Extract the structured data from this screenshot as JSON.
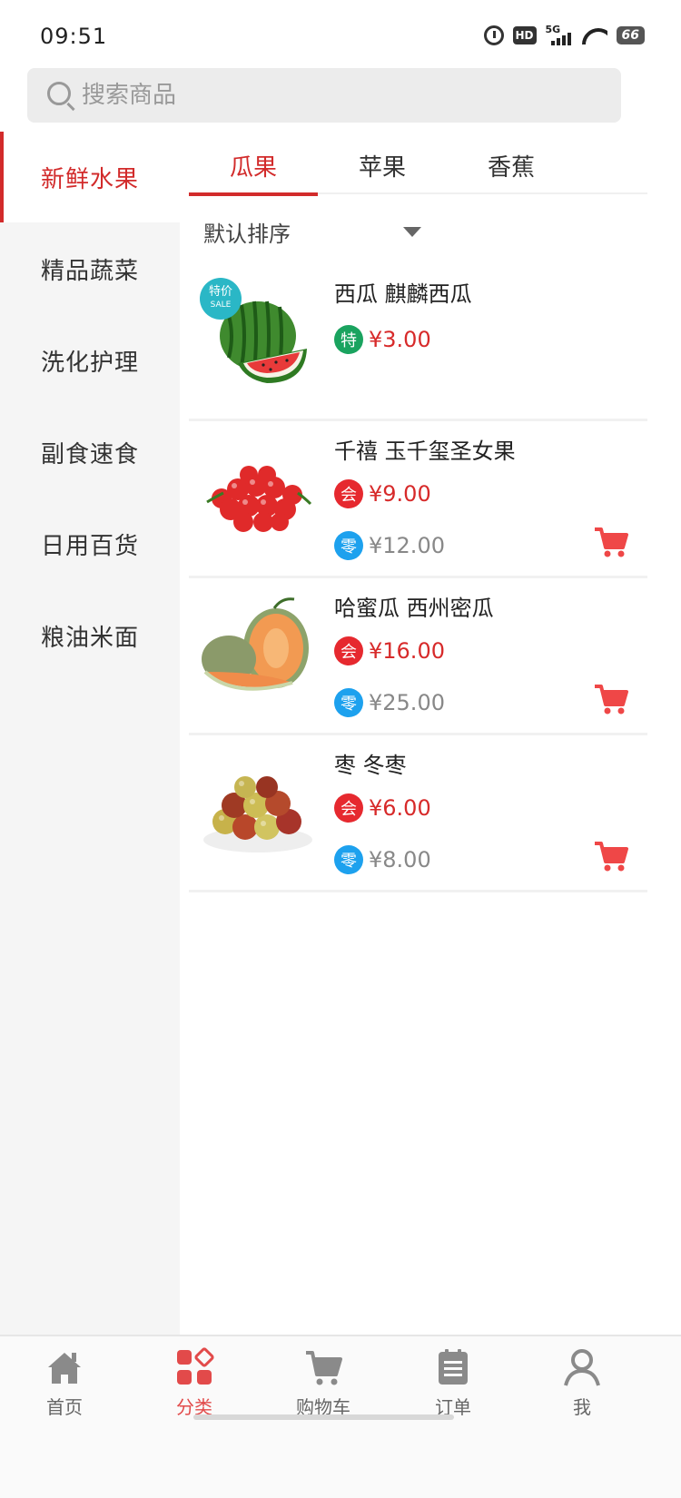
{
  "status": {
    "time": "09:51",
    "hd": "HD",
    "network": "5G",
    "battery": "66"
  },
  "search": {
    "placeholder": "搜索商品"
  },
  "sidebar": {
    "items": [
      {
        "label": "新鲜水果",
        "active": true
      },
      {
        "label": "精品蔬菜"
      },
      {
        "label": "洗化护理"
      },
      {
        "label": "副食速食"
      },
      {
        "label": "日用百货"
      },
      {
        "label": "粮油米面"
      }
    ]
  },
  "tabs": [
    {
      "label": "瓜果",
      "active": true
    },
    {
      "label": "苹果"
    },
    {
      "label": "香蕉"
    }
  ],
  "sort": {
    "label": "默认排序"
  },
  "products": [
    {
      "name": "西瓜 麒麟西瓜",
      "sale_tag": "特价",
      "sale_tag_en": "SALE",
      "badge": "特",
      "price": "¥3.00",
      "image": "watermelon"
    },
    {
      "name": "千禧 玉千玺圣女果",
      "member_badge": "会",
      "member_price": "¥9.00",
      "retail_badge": "零",
      "retail_price": "¥12.00",
      "image": "cherry-tomatoes"
    },
    {
      "name": "哈蜜瓜 西州密瓜",
      "member_badge": "会",
      "member_price": "¥16.00",
      "retail_badge": "零",
      "retail_price": "¥25.00",
      "image": "hami-melon"
    },
    {
      "name": "枣 冬枣",
      "member_badge": "会",
      "member_price": "¥6.00",
      "retail_badge": "零",
      "retail_price": "¥8.00",
      "image": "winter-jujube"
    }
  ],
  "nav": [
    {
      "label": "首页",
      "icon": "home-icon"
    },
    {
      "label": "分类",
      "icon": "category-icon",
      "active": true
    },
    {
      "label": "购物车",
      "icon": "cart-icon"
    },
    {
      "label": "订单",
      "icon": "order-icon"
    },
    {
      "label": "我",
      "icon": "user-icon"
    }
  ],
  "colors": {
    "accent": "#d22b2b",
    "special_badge": "#1aa35f",
    "member_badge": "#e6292f",
    "retail_badge": "#1da1ee"
  }
}
